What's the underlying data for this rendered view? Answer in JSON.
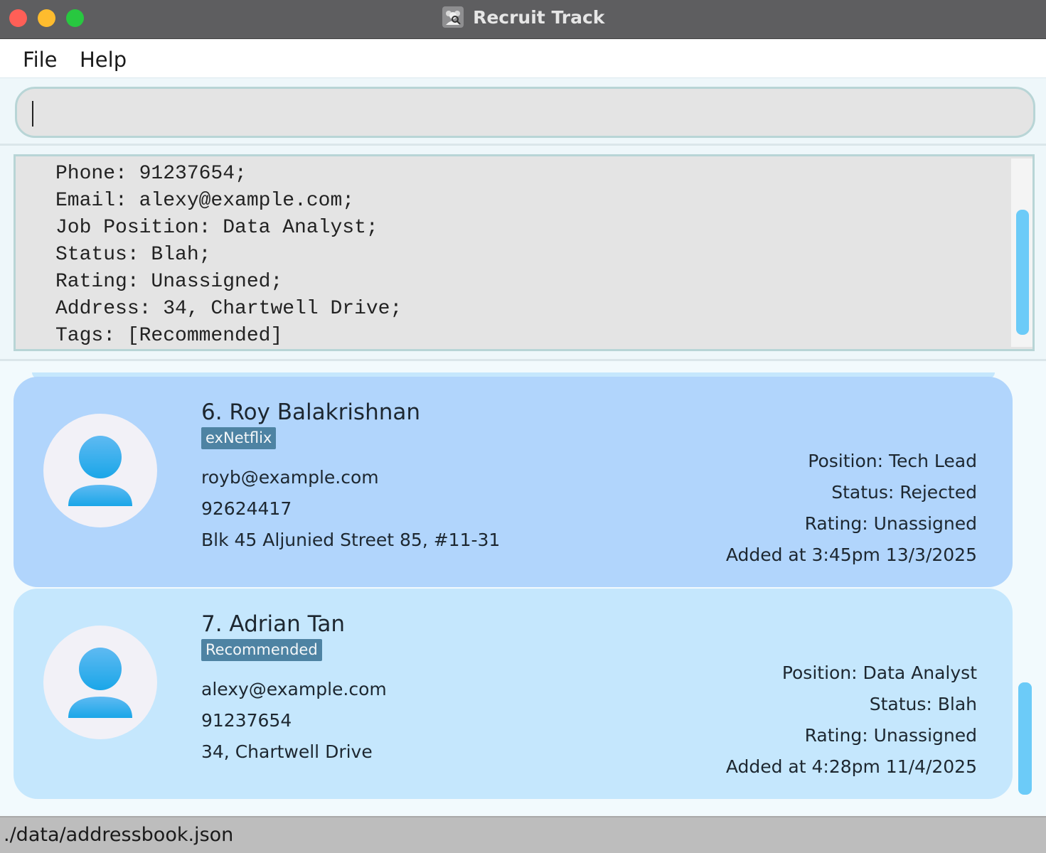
{
  "window": {
    "title": "Recruit Track",
    "icon": "recruit-people-icon"
  },
  "menu": {
    "file": "File",
    "help": "Help"
  },
  "command_box": {
    "value": "",
    "placeholder": ""
  },
  "result": {
    "lines": [
      "Phone: 91237654;",
      "Email: alexy@example.com;",
      "Job Position: Data Analyst;",
      "Status: Blah;",
      "Rating: Unassigned;",
      "Address: 34, Chartwell Drive;",
      "Tags: [Recommended]"
    ]
  },
  "persons": [
    {
      "index_name": "6. Roy Balakrishnan",
      "tag": "exNetflix",
      "email": "royb@example.com",
      "phone": "92624417",
      "address": "Blk 45 Aljunied Street 85, #11-31",
      "position": "Position:  Tech Lead",
      "status": "Status:  Rejected",
      "rating": "Rating:  Unassigned",
      "added": "Added at 3:45pm 13/3/2025"
    },
    {
      "index_name": "7. Adrian Tan",
      "tag": "Recommended",
      "email": "alexy@example.com",
      "phone": "91237654",
      "address": "34, Chartwell Drive",
      "position": "Position:  Data Analyst",
      "status": "Status:  Blah",
      "rating": "Rating:  Unassigned",
      "added": "Added at 4:28pm 11/4/2025"
    }
  ],
  "status_bar": {
    "path": "./data/addressbook.json"
  },
  "colors": {
    "accent": "#6ccbf8",
    "card_selected": "#b1d5fc",
    "card_normal": "#c5e7fd",
    "tag_bg": "#4e83a3"
  }
}
